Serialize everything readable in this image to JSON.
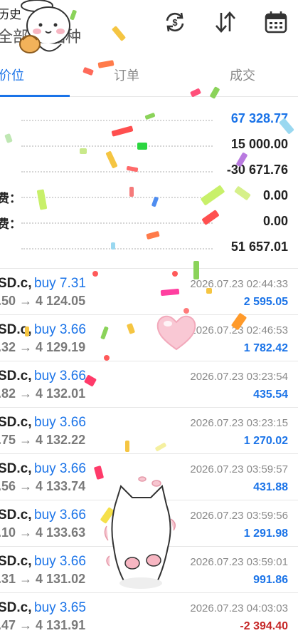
{
  "header": {
    "title_fragment": "历史",
    "subtitle_fragment": "全部",
    "subtitle_suffix": "品种",
    "icons": [
      "sync-dollar-icon",
      "sort-icon",
      "calendar-icon"
    ]
  },
  "tabs": [
    {
      "label": "价位",
      "active": true
    },
    {
      "label": "订单",
      "active": false
    },
    {
      "label": "成交",
      "active": false
    }
  ],
  "summary": [
    {
      "label": "",
      "value": "67 328.77",
      "accent": "blue"
    },
    {
      "label": "",
      "value": "15 000.00",
      "accent": "default"
    },
    {
      "label": "",
      "value": "-30 671.76",
      "accent": "default"
    },
    {
      "label": "费：",
      "value": "0.00",
      "accent": "default"
    },
    {
      "label": "费：",
      "value": "0.00",
      "accent": "default"
    },
    {
      "label": "",
      "value": "51 657.01",
      "accent": "default"
    }
  ],
  "positions": [
    {
      "symbol": "SD.c,",
      "side": "buy 7.31",
      "prices": ".50 → 4 124.05",
      "time": "2026.07.23 02:44:33",
      "profit": "2 595.05",
      "negative": false
    },
    {
      "symbol": "SD.c,",
      "side": "buy 3.66",
      "prices": ".32 → 4 129.19",
      "time": "2026.07.23 02:46:53",
      "profit": "1 782.42",
      "negative": false
    },
    {
      "symbol": "SD.c,",
      "side": "buy 3.66",
      "prices": ".82 → 4 132.01",
      "time": "2026.07.23 03:23:54",
      "profit": "435.54",
      "negative": false
    },
    {
      "symbol": "SD.c,",
      "side": "buy 3.66",
      "prices": ".75 → 4 132.22",
      "time": "2026.07.23 03:23:15",
      "profit": "1 270.02",
      "negative": false
    },
    {
      "symbol": "SD.c,",
      "side": "buy 3.66",
      "prices": ".56 → 4 133.74",
      "time": "2026.07.23 03:59:57",
      "profit": "431.88",
      "negative": false
    },
    {
      "symbol": "SD.c,",
      "side": "buy 3.66",
      "prices": ".10 → 4 133.63",
      "time": "2026.07.23 03:59:56",
      "profit": "1 291.98",
      "negative": false
    },
    {
      "symbol": "SD.c,",
      "side": "buy 3.66",
      "prices": ".31 → 4 131.02",
      "time": "2026.07.23 03:59:01",
      "profit": "991.86",
      "negative": false
    },
    {
      "symbol": "SD.c,",
      "side": "buy 3.65",
      "prices": ".47 → 4 131.91",
      "time": "2026.07.23 04:03:03",
      "profit": "-2 394.40",
      "negative": true
    }
  ],
  "colors": {
    "accent": "#1a73e8",
    "negative": "#c62828"
  }
}
